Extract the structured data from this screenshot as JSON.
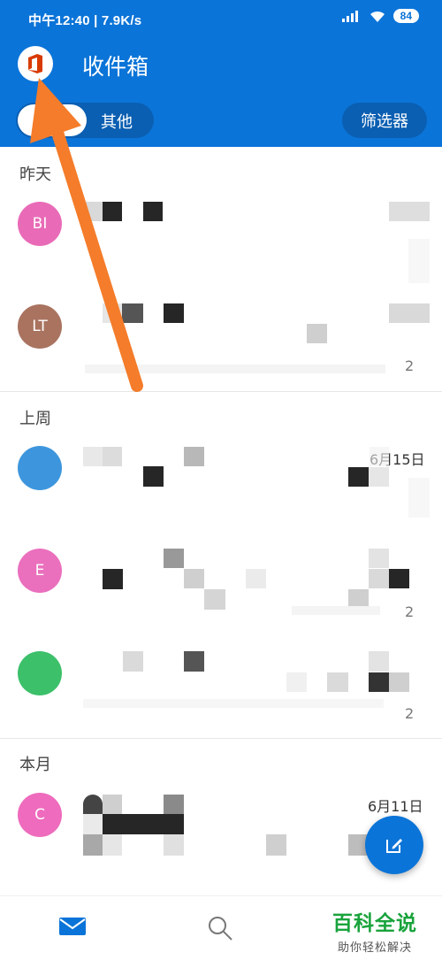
{
  "status_bar": {
    "left_text": "中午12:40 | 7.9K/s",
    "battery": "84"
  },
  "header": {
    "title": "收件箱",
    "tabs": [
      {
        "label": "",
        "active": true
      },
      {
        "label": "其他",
        "active": false
      }
    ],
    "filter_label": "筛选器"
  },
  "sections": [
    {
      "label": "昨天"
    },
    {
      "label": "上周"
    },
    {
      "label": "本月"
    }
  ],
  "messages": [
    {
      "avatar_initials": "BI",
      "avatar_color": "#e96bb7"
    },
    {
      "avatar_initials": "LT",
      "avatar_color": "#a97360",
      "count": "2"
    },
    {
      "avatar_initials": "",
      "avatar_color": "#3d96dd",
      "date": "6月15日"
    },
    {
      "avatar_initials": "E",
      "avatar_color": "#ea6fbd",
      "count": "2"
    },
    {
      "avatar_initials": "",
      "avatar_color": "#3cc06a",
      "count": "2"
    },
    {
      "avatar_initials": "C",
      "avatar_color": "#ee6bbd",
      "date": "6月11日"
    }
  ],
  "watermark": {
    "title": "百科全说",
    "subtitle": "助你轻松解决"
  },
  "icons": {
    "app_logo": "office-logo-icon",
    "compose": "compose-icon",
    "mail": "mail-icon",
    "search": "search-icon"
  },
  "colors": {
    "brand": "#0b74d8",
    "arrow": "#f47c2a",
    "watermark": "#19a33c"
  }
}
